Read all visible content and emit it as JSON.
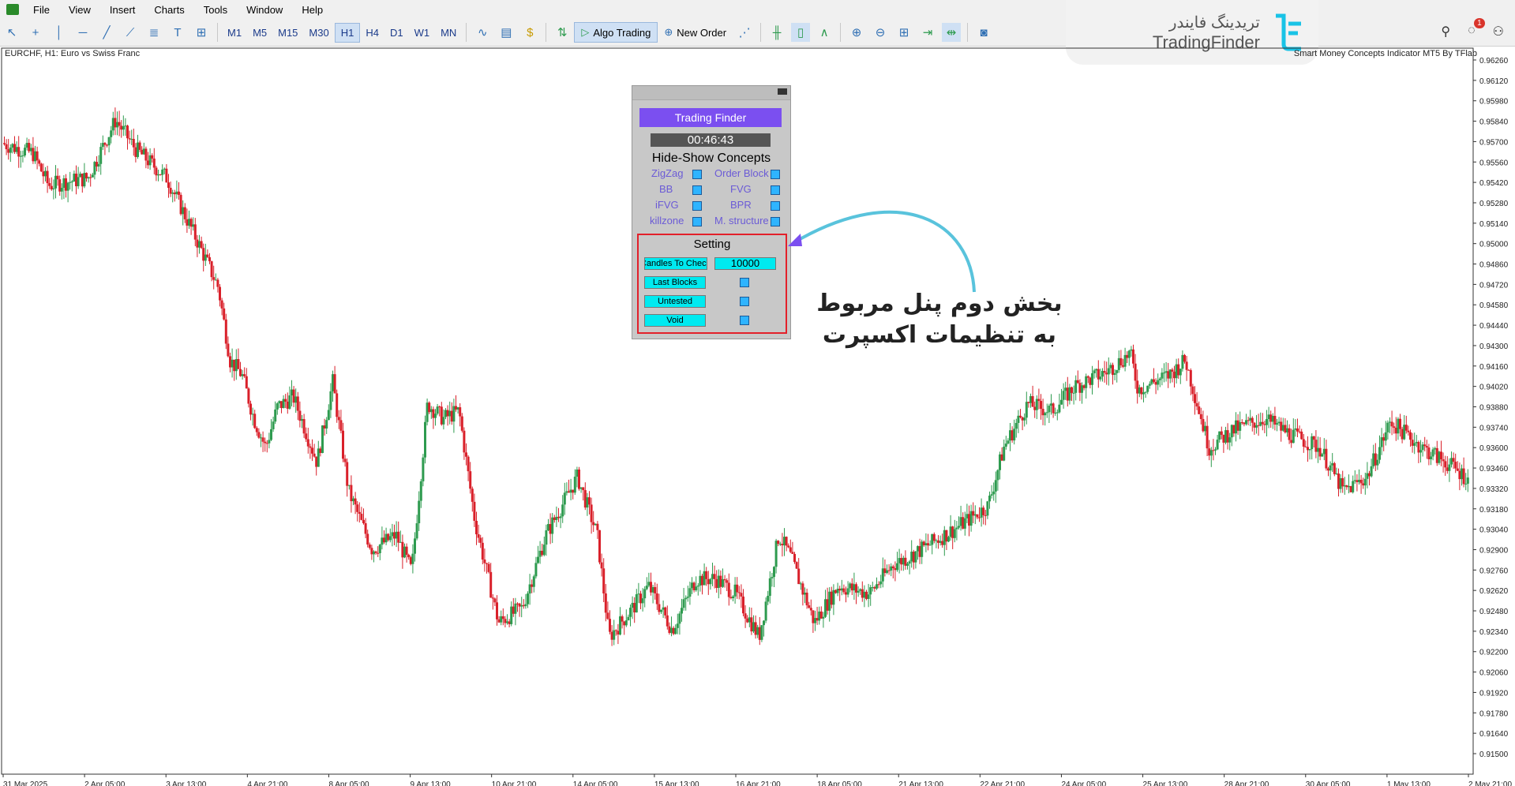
{
  "menu": [
    "File",
    "View",
    "Insert",
    "Charts",
    "Tools",
    "Window",
    "Help"
  ],
  "timeframes": [
    "M1",
    "M5",
    "M15",
    "M30",
    "H1",
    "H4",
    "D1",
    "W1",
    "MN"
  ],
  "active_timeframe": "H1",
  "toolbar": {
    "algo_trading": "Algo Trading",
    "new_order": "New Order"
  },
  "notification_count": "1",
  "logo": {
    "fa": "تریدینگ فایندر",
    "en": "TradingFinder"
  },
  "chart": {
    "symbol_label": "EURCHF, H1:  Euro vs Swiss Franc",
    "indicator_label": "Smart Money Concepts Indicator MT5 By TFlab",
    "price_ticks": [
      "0.96260",
      "0.96120",
      "0.95980",
      "0.95840",
      "0.95700",
      "0.95560",
      "0.95420",
      "0.95280",
      "0.95140",
      "0.95000",
      "0.94860",
      "0.94720",
      "0.94580",
      "0.94440",
      "0.94300",
      "0.94160",
      "0.94020",
      "0.93880",
      "0.93740",
      "0.93600",
      "0.93460",
      "0.93320",
      "0.93180",
      "0.93040",
      "0.92900",
      "0.92760",
      "0.92620",
      "0.92480",
      "0.92340",
      "0.92200",
      "0.92060",
      "0.91920",
      "0.91780",
      "0.91640",
      "0.91500"
    ],
    "time_ticks": [
      "31 Mar 2025",
      "2 Apr 05:00",
      "3 Apr 13:00",
      "4 Apr 21:00",
      "8 Apr 05:00",
      "9 Apr 13:00",
      "10 Apr 21:00",
      "14 Apr 05:00",
      "15 Apr 13:00",
      "16 Apr 21:00",
      "18 Apr 05:00",
      "21 Apr 13:00",
      "22 Apr 21:00",
      "24 Apr 05:00",
      "25 Apr 13:00",
      "28 Apr 21:00",
      "30 Apr 05:00",
      "1 May 13:00",
      "2 May 21:00"
    ],
    "colors": {
      "bull": "#2e9b4f",
      "bear": "#d9202a"
    }
  },
  "panel": {
    "brand": "Trading Finder",
    "clock": "00:46:43",
    "concepts_title": "Hide-Show Concepts",
    "concepts_left": [
      "ZigZag",
      "BB",
      "iFVG",
      "killzone"
    ],
    "concepts_right": [
      "Order Block",
      "FVG",
      "BPR",
      "M. structure"
    ],
    "setting_title": "Setting",
    "candles_label": "Candles To Check",
    "candles_value": "10000",
    "last_blocks": "Last Blocks",
    "untested": "Untested",
    "void": "Void"
  },
  "annotation": {
    "line1": "بخش دوم پنل مربوط",
    "line2": "به تنظیمات اکسپرت"
  }
}
